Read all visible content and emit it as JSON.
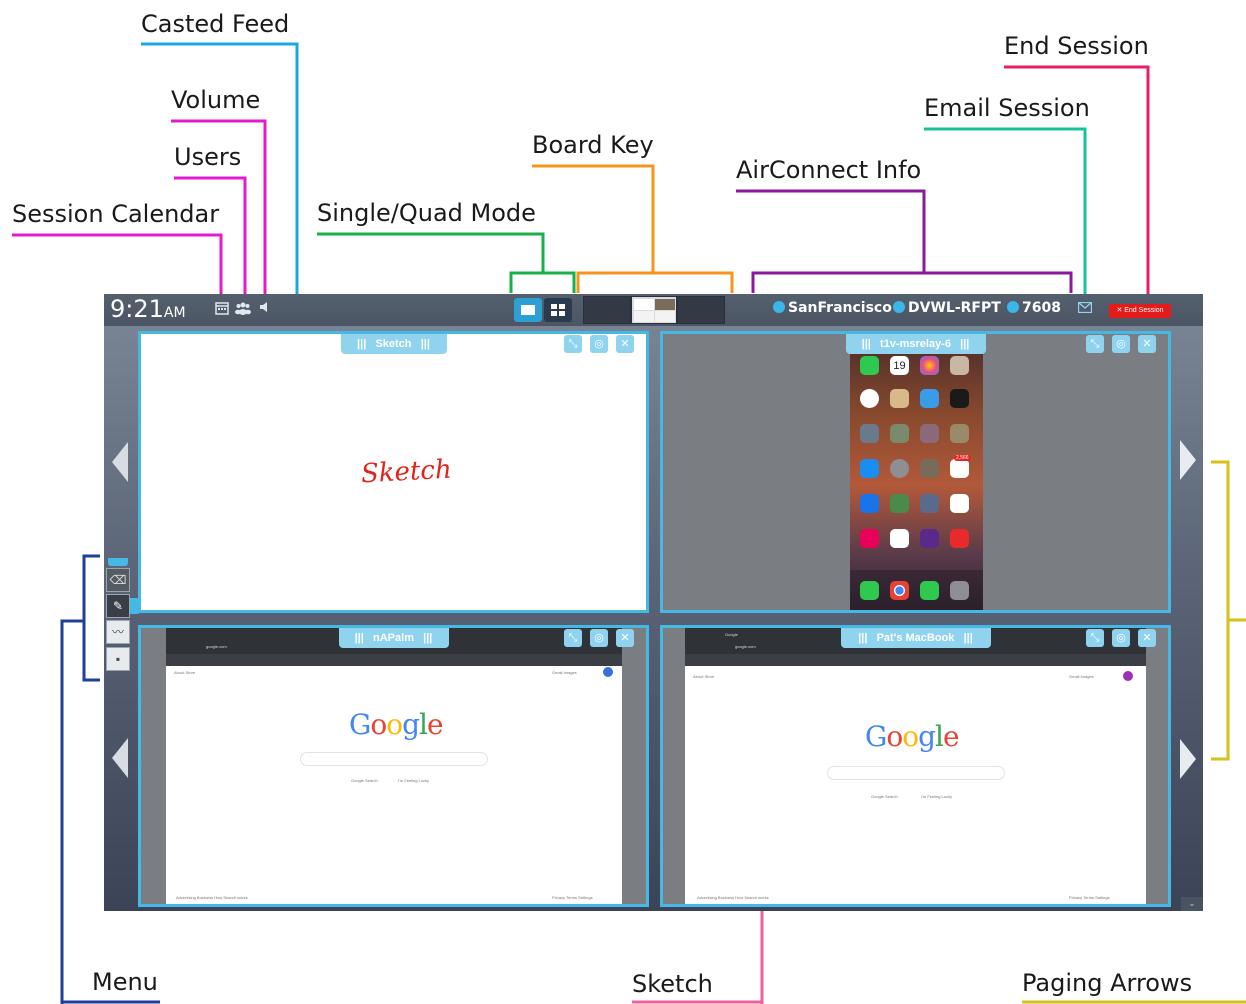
{
  "annotations": {
    "casted_feed": "Casted Feed",
    "volume": "Volume",
    "users": "Users",
    "session_calendar": "Session Calendar",
    "single_quad_mode": "Single/Quad Mode",
    "board_key": "Board Key",
    "airconnect_info": "AirConnect Info",
    "email_session": "Email Session",
    "end_session": "End Session",
    "menu": "Menu",
    "sketch": "Sketch",
    "paging_arrows": "Paging Arrows"
  },
  "annotation_colors": {
    "casted_feed": "#1aa8e0",
    "volume": "#e21bd0",
    "users": "#e21bd0",
    "session_calendar": "#e21bd0",
    "single_quad_mode": "#18b04a",
    "board_key": "#f7941d",
    "airconnect_info": "#8a1a9b",
    "email_session": "#18c19c",
    "end_session": "#ea1e63",
    "menu": "#1f3f9a",
    "sketch": "#f0609a",
    "paging_arrows": "#d6c21a"
  },
  "topbar": {
    "time": "9:21",
    "ampm": "AM",
    "calendar_icon": "calendar-icon",
    "users_icon": "users-icon",
    "volume_icon": "volume-icon",
    "location": "SanFrancisco",
    "room": "DVWL-RFPT",
    "key": "7608",
    "end_session_label": "End Session"
  },
  "panels": [
    {
      "title": "Sketch",
      "content_text": "Sketch"
    },
    {
      "title": "t1v-msrelay-6",
      "calendar_day": "19"
    },
    {
      "title": "nAPalm"
    },
    {
      "title": "Pat's MacBook"
    }
  ],
  "browser": {
    "tab_text": "Google",
    "address": "google.com",
    "logo": "Google",
    "btn_search": "Google Search",
    "btn_lucky": "I'm Feeling Lucky",
    "links_left": "About   Store",
    "links_right": "Gmail   Images",
    "footer_left": "Advertising   Business   How Search works",
    "footer_right": "Privacy   Terms   Settings"
  },
  "phone_badges": {
    "mail": "2,566"
  }
}
